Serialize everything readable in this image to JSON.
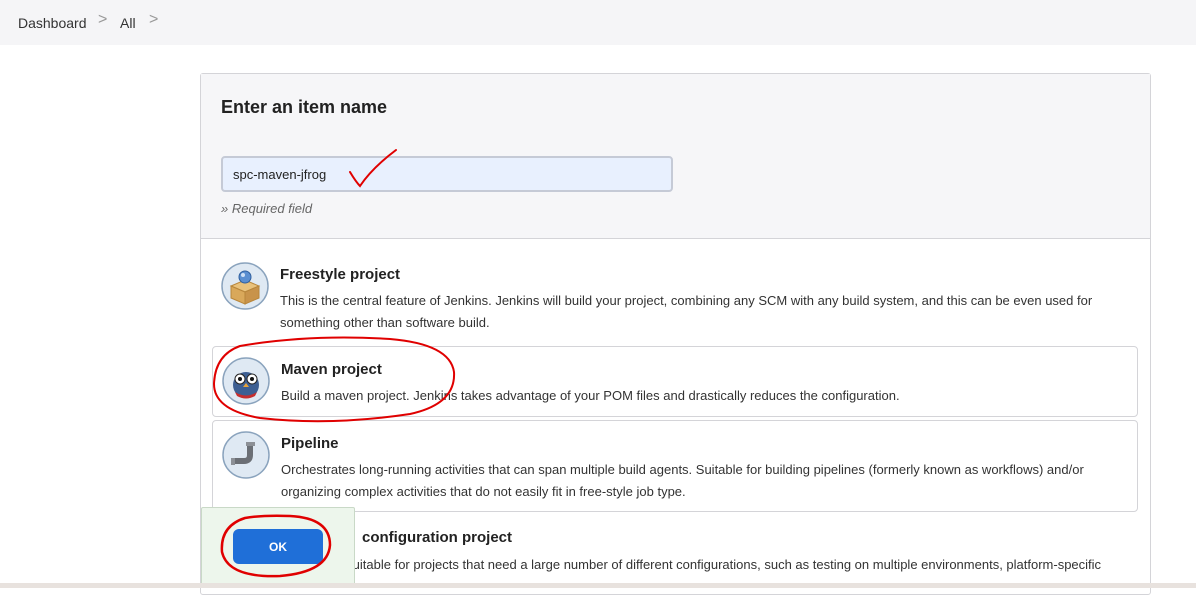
{
  "breadcrumb": {
    "items": [
      "Dashboard",
      "All"
    ],
    "separator": ">"
  },
  "form": {
    "heading": "Enter an item name",
    "name_value": "spc-maven-jfrog",
    "required_hint": "» Required field"
  },
  "item_types": [
    {
      "title": "Freestyle project",
      "description": "This is the central feature of Jenkins. Jenkins will build your project, combining any SCM with any build system, and this can be even used for something other than software build.",
      "icon": "freestyle-box-icon"
    },
    {
      "title": "Maven project",
      "description": "Build a maven project. Jenkins takes advantage of your POM files and drastically reduces the configuration.",
      "icon": "maven-owl-icon"
    },
    {
      "title": "Pipeline",
      "description": "Orchestrates long-running activities that can span multiple build agents. Suitable for building pipelines (formerly known as workflows) and/or organizing complex activities that do not easily fit in free-style job type.",
      "icon": "pipeline-pipe-icon"
    },
    {
      "title_visible": "configuration project",
      "description_visible": "Suitable for projects that need a large number of different configurations, such as testing on multiple environments, platform-specific"
    }
  ],
  "ok_button": {
    "label": "OK"
  },
  "colors": {
    "accent": "#1f6fd8",
    "annotation": "#e00000",
    "input_bg": "#e8f0fe"
  }
}
